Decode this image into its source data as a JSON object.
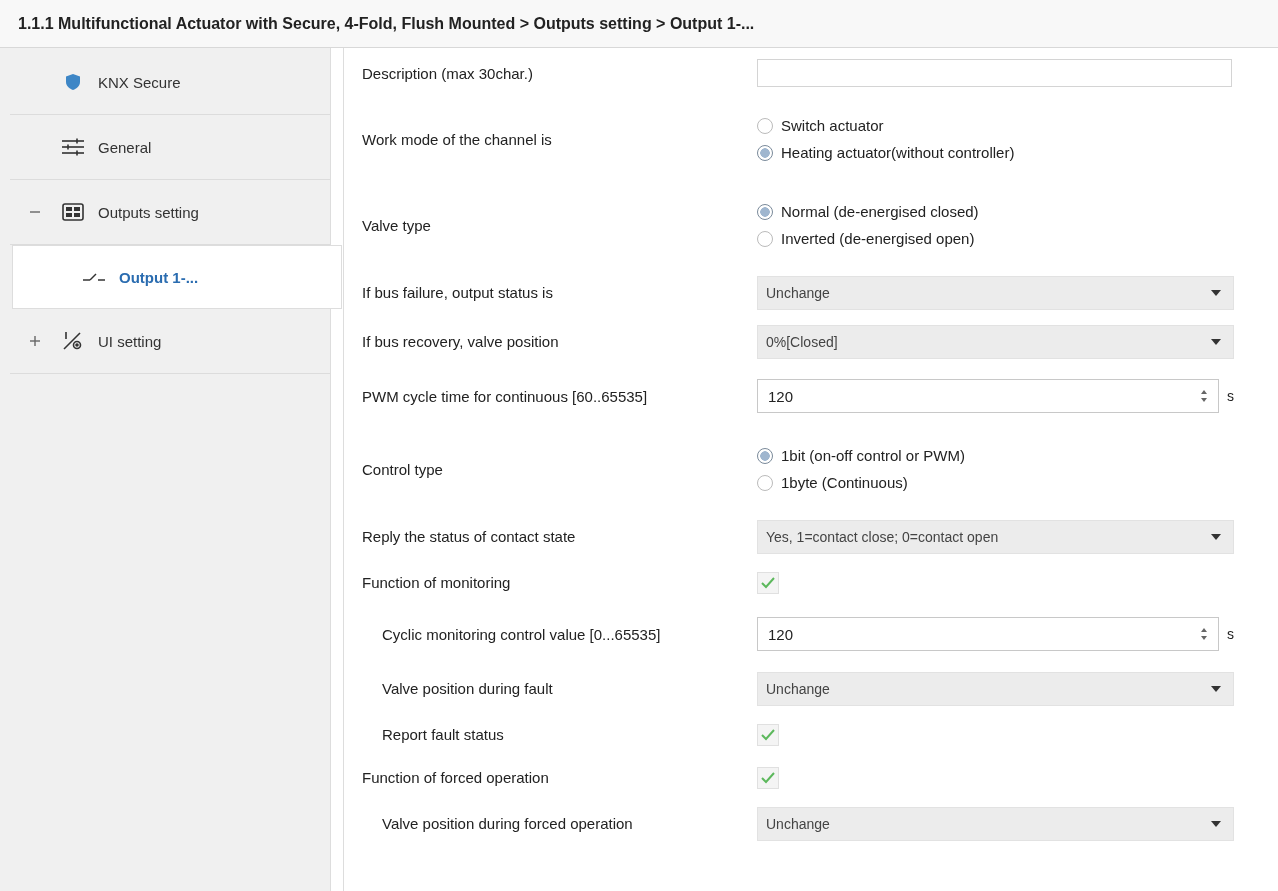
{
  "breadcrumb": "1.1.1 Multifunctional Actuator with Secure, 4-Fold, Flush Mounted > Outputs setting > Output 1-...",
  "sidebar": {
    "items": [
      {
        "label": "KNX Secure",
        "selected": false
      },
      {
        "label": "General",
        "selected": false
      },
      {
        "label": "Outputs setting",
        "selected": false,
        "expanded": true,
        "children": [
          {
            "label": "Output 1-...",
            "selected": true
          }
        ]
      },
      {
        "label": "UI setting",
        "selected": false,
        "expanded": false
      }
    ]
  },
  "parameters": [
    {
      "kind": "text",
      "label": "Description (max 30char.)"
    },
    {
      "kind": "radio",
      "label": "Work mode of the channel is",
      "options": [
        {
          "label": "Switch actuator",
          "selected": false
        },
        {
          "label": "Heating actuator(without controller)",
          "selected": true
        }
      ]
    },
    {
      "kind": "radio",
      "label": "Valve type",
      "options": [
        {
          "label": "Normal (de-energised closed)",
          "selected": true
        },
        {
          "label": "Inverted (de-energised open)",
          "selected": false
        }
      ]
    },
    {
      "kind": "select",
      "label": "If bus failure, output status is",
      "value": "Unchange"
    },
    {
      "kind": "select",
      "label": "If bus recovery, valve position",
      "value": "0%[Closed]"
    },
    {
      "kind": "number",
      "label": "PWM cycle time for continuous [60..65535]",
      "value": "120",
      "unit": "s"
    },
    {
      "kind": "radio",
      "label": "Control type",
      "options": [
        {
          "label": "1bit (on-off control or PWM)",
          "selected": true
        },
        {
          "label": "1byte (Continuous)",
          "selected": false
        }
      ]
    },
    {
      "kind": "select",
      "label": "Reply the status of contact state",
      "value": "Yes, 1=contact close; 0=contact open"
    },
    {
      "kind": "checkbox",
      "label": "Function of monitoring",
      "checked": true,
      "children": [
        {
          "kind": "number",
          "label": "Cyclic monitoring control value [0...65535]",
          "value": "120",
          "unit": "s"
        },
        {
          "kind": "select",
          "label": "Valve position during fault",
          "value": "Unchange"
        },
        {
          "kind": "checkbox",
          "label": "Report fault status",
          "checked": true
        }
      ]
    },
    {
      "kind": "checkbox",
      "label": "Function of forced operation",
      "checked": true,
      "children": [
        {
          "kind": "select",
          "label": "Valve position during forced operation",
          "value": "Unchange"
        }
      ]
    }
  ]
}
